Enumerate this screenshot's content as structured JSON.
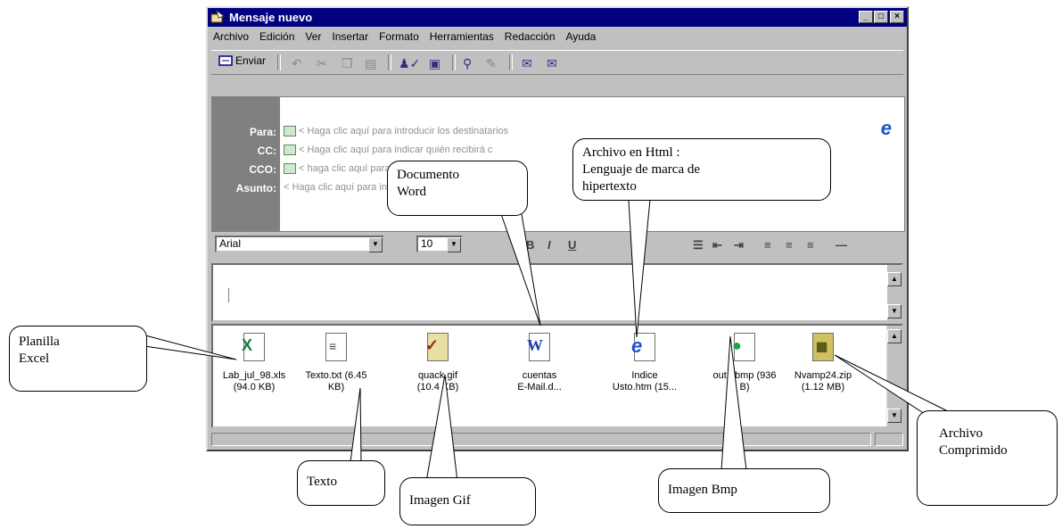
{
  "window": {
    "title": "Mensaje nuevo",
    "controls": {
      "minimize": "_",
      "maximize": "□",
      "close": "×"
    }
  },
  "menu": [
    "Archivo",
    "Edición",
    "Ver",
    "Insertar",
    "Formato",
    "Herramientas",
    "Redacción",
    "Ayuda"
  ],
  "toolbar": {
    "send_label": "Enviar",
    "icons": [
      "undo-icon",
      "cut-icon",
      "copy-icon",
      "paste-icon",
      "check-names-icon",
      "select-recipients-icon",
      "attach-icon",
      "sign-icon",
      "encrypt-icon",
      "offline-icon"
    ]
  },
  "header": {
    "to_label": "Para:",
    "to_value": "< Haga clic aquí para introducir los destinatarios",
    "cc_label": "CC:",
    "cc_value": "< Haga clic aquí para indicar quién recibirá c",
    "bcc_label": "CCO:",
    "bcc_value": "< haga clic aquí para introducir los destinatarios",
    "subject_label": "Asunto:",
    "subject_value": "< Haga clic aquí para introducir el asunto >"
  },
  "format": {
    "font": "Arial",
    "size": "10",
    "buttons": [
      "B",
      "I",
      "U"
    ]
  },
  "attachments": [
    {
      "icon": "excel-file-icon",
      "line1": "Lab_jul_98.xls",
      "line2": "(94.0 KB)"
    },
    {
      "icon": "text-file-icon",
      "line1": "Texto.txt (6.45",
      "line2": "KB)"
    },
    {
      "icon": "gif-file-icon",
      "line1": "quack.gif",
      "line2": "(10.4 KB)"
    },
    {
      "icon": "word-file-icon",
      "line1": "cuentas",
      "line2": "E-Mail.d..."
    },
    {
      "icon": "html-file-icon",
      "line1": "Indice",
      "line2": "Usto.htm (15..."
    },
    {
      "icon": "bmp-file-icon",
      "line1": "out1.bmp (936",
      "line2": "B)"
    },
    {
      "icon": "zip-file-icon",
      "line1": "Nvamp24.zip",
      "line2": "(1.12 MB)"
    }
  ],
  "callouts": {
    "excel": [
      "Planilla",
      "Excel"
    ],
    "texto": [
      "Texto"
    ],
    "gif": [
      "Imagen Gif"
    ],
    "word": [
      "Documento",
      "Word"
    ],
    "html": [
      "Archivo en Html :",
      "Lenguaje de marca de",
      "hipertexto"
    ],
    "bmp": [
      "Imagen Bmp"
    ],
    "zip": [
      "Archivo",
      "Comprimido"
    ]
  },
  "colors": {
    "titlebar": "#000080",
    "window_face": "#c0c0c0",
    "header_label_bg": "#808080"
  }
}
